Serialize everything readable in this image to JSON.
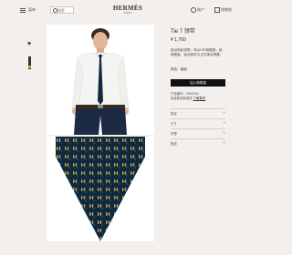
{
  "header": {
    "menu_label": "菜单",
    "search_placeholder": "搜索",
    "brand": "HERMÈS",
    "brand_sub": "PARIS",
    "account_label": "账户",
    "bag_label": "购物袋"
  },
  "product": {
    "title": "Tie 7 领带",
    "price": "¥ 1,760",
    "description": "真丝斜纹领带，饰以H字母图案，经典宽度，适合商务与正式场合佩戴。",
    "color_label": "颜色：",
    "color_value": "藏蓝",
    "add_to_bag": "加入购物袋",
    "sku": "产品编号：H000000",
    "shipping_prefix": "免费配送和退货",
    "shipping_link": "了解更多",
    "accordion": [
      {
        "label": "描述",
        "icon": "+"
      },
      {
        "label": "尺寸",
        "icon": "+"
      },
      {
        "label": "护理",
        "icon": "+"
      },
      {
        "label": "配送",
        "icon": "+"
      }
    ]
  },
  "colors": {
    "background": "#f2efec",
    "tie_navy": "#0f2a3f",
    "pattern_gold": "#b89a4e",
    "button": "#111111"
  }
}
